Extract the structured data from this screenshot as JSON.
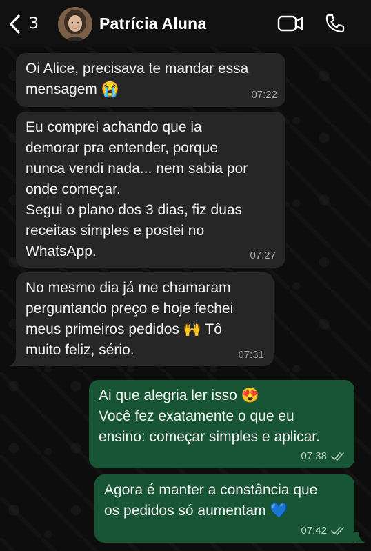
{
  "header": {
    "back_count": "3",
    "contact_name": "Patrícia Aluna",
    "icons": [
      "back-chevron-icon",
      "video-call-icon",
      "phone-call-icon"
    ]
  },
  "messages": [
    {
      "direction": "incoming",
      "text": "Oi Alice, precisava te mandar essa\nmensagem 😭",
      "time": "07:22"
    },
    {
      "direction": "incoming",
      "text": "Eu comprei achando que ia\ndemorar pra entender, porque\nnunca vendi nada... nem sabia por\nonde começar.\nSegui o plano dos 3 dias, fiz duas\nreceitas simples e postei no\nWhatsApp.",
      "time": "07:27"
    },
    {
      "direction": "incoming",
      "text": "No mesmo dia já me chamaram\nperguntando preço e hoje fechei\nmeus primeiros pedidos 🙌 Tô\nmuito feliz, sério.",
      "time": "07:31"
    },
    {
      "direction": "outgoing",
      "text": "Ai que alegria ler isso 😍\nVocê fez exatamente o que eu\nensino: começar simples e aplicar.",
      "time": "07:38",
      "status": "read"
    },
    {
      "direction": "outgoing",
      "text": "Agora é manter a constância que\nos pedidos só aumentam 💙",
      "time": "07:42",
      "status": "read"
    }
  ],
  "colors": {
    "background": "#0d0d0d",
    "header": "#111111",
    "incoming_bubble": "#262626",
    "outgoing_bubble": "#175534"
  }
}
